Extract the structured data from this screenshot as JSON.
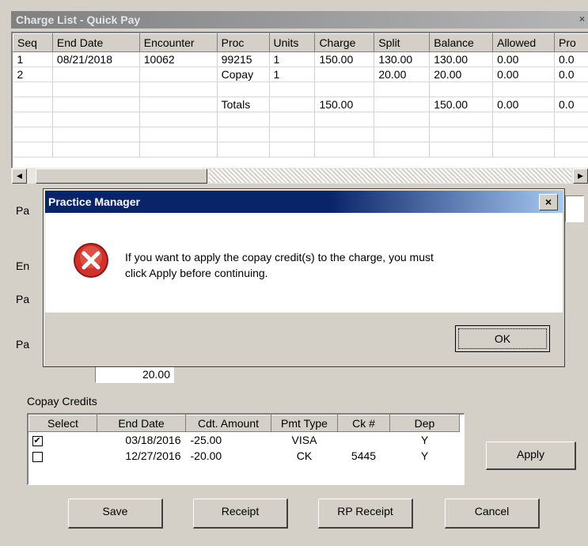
{
  "window": {
    "title": "Charge List - Quick Pay",
    "close_glyph": "×"
  },
  "charge_table": {
    "columns": [
      "Seq",
      "End Date",
      "Encounter",
      "Proc",
      "Units",
      "Charge",
      "Split",
      "Balance",
      "Allowed",
      "Pro"
    ],
    "rows": [
      [
        "1",
        "08/21/2018",
        "10062",
        "99215",
        "1",
        "150.00",
        "130.00",
        "130.00",
        "0.00",
        "0.0"
      ],
      [
        "2",
        "",
        "",
        "Copay",
        "1",
        "",
        "20.00",
        "20.00",
        "0.00",
        "0.0"
      ],
      [
        "",
        "",
        "",
        "",
        "",
        "",
        "",
        "",
        "",
        ""
      ],
      [
        "",
        "",
        "",
        "Totals",
        "",
        "150.00",
        "",
        "150.00",
        "0.00",
        "0.0"
      ],
      [
        "",
        "",
        "",
        "",
        "",
        "",
        "",
        "",
        "",
        ""
      ],
      [
        "",
        "",
        "",
        "",
        "",
        "",
        "",
        "",
        "",
        ""
      ],
      [
        "",
        "",
        "",
        "",
        "",
        "",
        "",
        "",
        "",
        ""
      ]
    ]
  },
  "side_labels": [
    "Pa",
    "En",
    "Pa",
    "Pa"
  ],
  "amount_value": "20.00",
  "copay": {
    "label": "Copay Credits",
    "columns": [
      "Select",
      "End Date",
      "Cdt. Amount",
      "Pmt Type",
      "Ck #",
      "Dep"
    ],
    "rows": [
      {
        "checked": true,
        "end_date": "03/18/2016",
        "amount": "-25.00",
        "pmt_type": "VISA",
        "ck": "",
        "dep": "Y"
      },
      {
        "checked": false,
        "end_date": "12/27/2016",
        "amount": "-20.00",
        "pmt_type": "CK",
        "ck": "5445",
        "dep": "Y"
      }
    ]
  },
  "buttons": {
    "apply": "Apply",
    "save": "Save",
    "receipt": "Receipt",
    "rp_receipt": "RP Receipt",
    "cancel": "Cancel"
  },
  "dialog": {
    "title": "Practice Manager",
    "close_glyph": "×",
    "message_line1": "If you want to apply the copay credit(s) to the charge, you must",
    "message_line2": "click Apply before continuing.",
    "ok_label": "OK",
    "icon": "error-icon"
  },
  "colors": {
    "dialog_title_bg": "#0a246a",
    "error_red": "#d4302a",
    "window_bg": "#d4d0c8"
  }
}
